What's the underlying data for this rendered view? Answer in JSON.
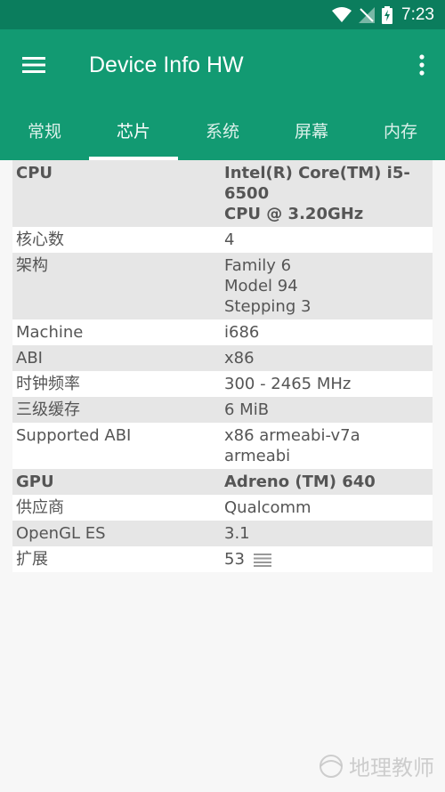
{
  "status_bar": {
    "time": "7:23"
  },
  "app_bar": {
    "title": "Device Info HW"
  },
  "tabs": [
    {
      "label": "常规"
    },
    {
      "label": "芯片"
    },
    {
      "label": "系统"
    },
    {
      "label": "屏幕"
    },
    {
      "label": "内存"
    }
  ],
  "active_tab": "芯片",
  "rows": [
    {
      "key": "CPU",
      "value": "Intel(R) Core(TM) i5-6500\nCPU @ 3.20GHz"
    },
    {
      "key": "核心数",
      "value": "4"
    },
    {
      "key": "架构",
      "value": "Family 6\nModel 94\nStepping 3"
    },
    {
      "key": "Machine",
      "value": "i686"
    },
    {
      "key": "ABI",
      "value": "x86"
    },
    {
      "key": "时钟频率",
      "value": "300 - 2465 MHz"
    },
    {
      "key": "三级缓存",
      "value": "6 MiB"
    },
    {
      "key": "Supported ABI",
      "value": "x86 armeabi-v7a armeabi"
    },
    {
      "key": "GPU",
      "value": "Adreno (TM) 640"
    },
    {
      "key": "供应商",
      "value": "Qualcomm"
    },
    {
      "key": "OpenGL ES",
      "value": "3.1"
    },
    {
      "key": "扩展",
      "value": "53"
    }
  ],
  "watermark": "地理教师",
  "colors": {
    "status_bar": "#0b7d5d",
    "app_bar": "#129a72",
    "alt_row": "#e6e6e6"
  }
}
